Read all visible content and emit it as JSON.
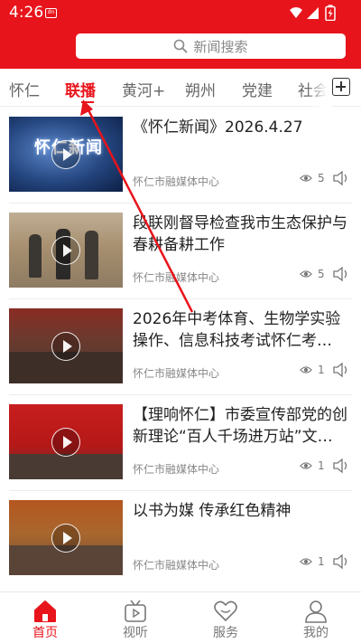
{
  "status_bar": {
    "time": "4:26",
    "notification_icon": "app-notification-icon"
  },
  "search": {
    "placeholder": "新闻搜索",
    "icon": "search-icon"
  },
  "tabs": [
    {
      "label": "怀仁",
      "active": false
    },
    {
      "label": "联播",
      "active": true
    },
    {
      "label": "黄河+",
      "active": false
    },
    {
      "label": "朔州",
      "active": false
    },
    {
      "label": "党建",
      "active": false
    },
    {
      "label": "社会",
      "active": false
    }
  ],
  "news": [
    {
      "title": "《怀仁新闻》2026.4.27",
      "source": "怀仁市融媒体中心",
      "views": "5",
      "thumb_text": "怀仁新闻"
    },
    {
      "title": "段联刚督导检查我市生态保护与春耕备耕工作",
      "source": "怀仁市融媒体中心",
      "views": "5"
    },
    {
      "title": "2026年中考体育、生物学实验操作、信息科技考试怀仁考…",
      "source": "怀仁市融媒体中心",
      "views": "1"
    },
    {
      "title": "【理响怀仁】市委宣传部党的创新理论“百人千场进万站”文…",
      "source": "怀仁市融媒体中心",
      "views": "1"
    },
    {
      "title": "以书为媒 传承红色精神",
      "source": "怀仁市融媒体中心",
      "views": "1"
    }
  ],
  "bottom_nav": [
    {
      "label": "首页",
      "icon": "home-icon",
      "active": true
    },
    {
      "label": "视听",
      "icon": "tv-icon",
      "active": false
    },
    {
      "label": "服务",
      "icon": "heart-icon",
      "active": false
    },
    {
      "label": "我的",
      "icon": "user-icon",
      "active": false
    }
  ],
  "colors": {
    "brand_red": "#e8141b",
    "text_dark": "#222222",
    "text_gray": "#888888"
  }
}
